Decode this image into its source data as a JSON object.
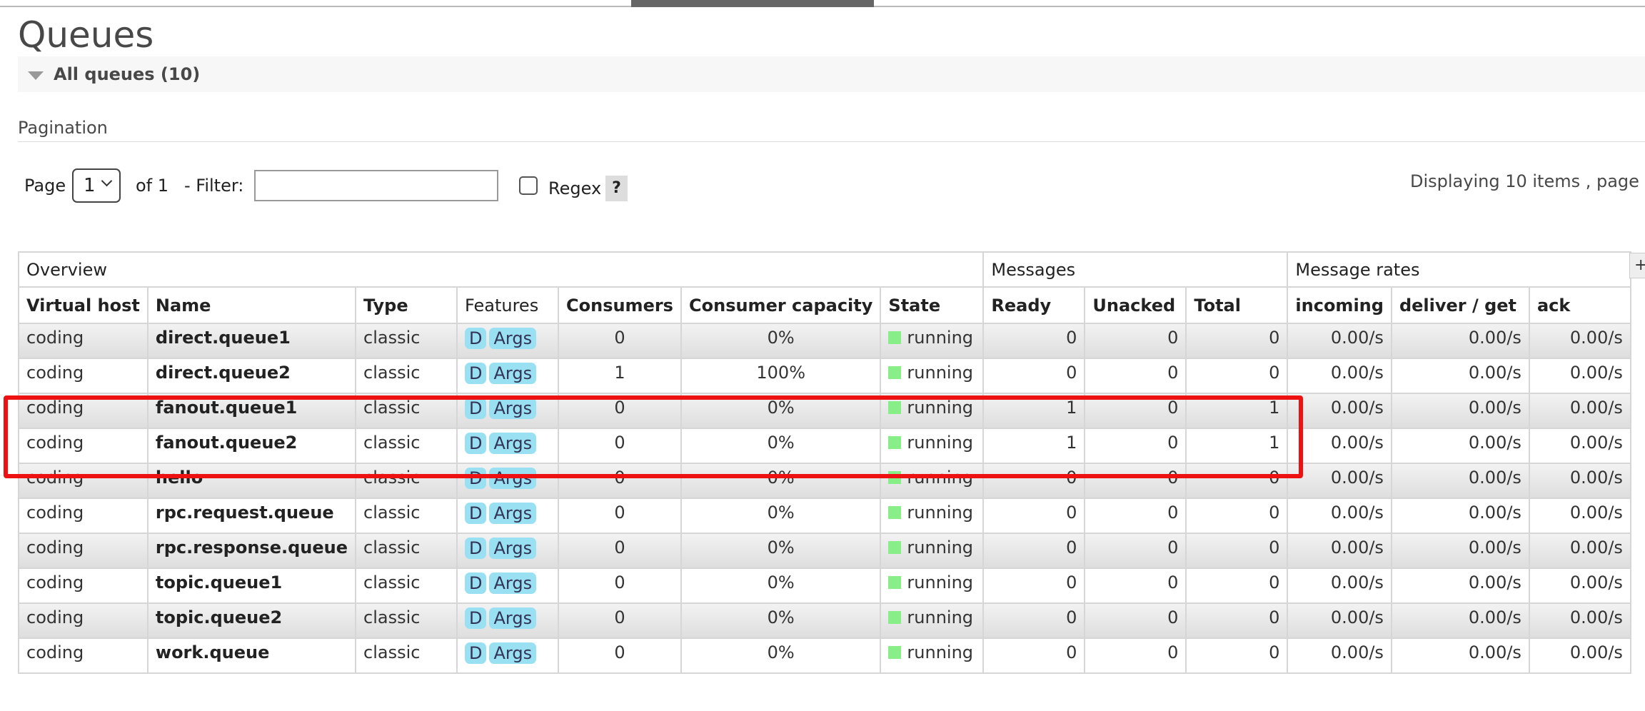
{
  "page": {
    "title": "Queues"
  },
  "section": {
    "label": "All queues (10)"
  },
  "pagination": {
    "label": "Pagination",
    "page_label": "Page",
    "page_value": "1",
    "of_label": "of 1",
    "filter_label": "- Filter:",
    "filter_value": "",
    "regex_label": "Regex",
    "regex_checked": false,
    "help_label": "?",
    "displaying": "Displaying 10 items , page"
  },
  "table": {
    "groups": [
      {
        "label": "Overview",
        "span": 7
      },
      {
        "label": "Messages",
        "span": 3
      },
      {
        "label": "Message rates",
        "span": 3
      }
    ],
    "side_button": "+",
    "columns": [
      "Virtual host",
      "Name",
      "Type",
      "Features",
      "Consumers",
      "Consumer capacity",
      "State",
      "Ready",
      "Unacked",
      "Total",
      "incoming",
      "deliver / get",
      "ack"
    ],
    "rows": [
      {
        "vhost": "coding",
        "name": "direct.queue1",
        "type": "classic",
        "features": [
          "D",
          "Args"
        ],
        "consumers": "0",
        "capacity": "0%",
        "state": "running",
        "ready": "0",
        "unacked": "0",
        "total": "0",
        "incoming": "0.00/s",
        "deliver_get": "0.00/s",
        "ack": "0.00/s"
      },
      {
        "vhost": "coding",
        "name": "direct.queue2",
        "type": "classic",
        "features": [
          "D",
          "Args"
        ],
        "consumers": "1",
        "capacity": "100%",
        "state": "running",
        "ready": "0",
        "unacked": "0",
        "total": "0",
        "incoming": "0.00/s",
        "deliver_get": "0.00/s",
        "ack": "0.00/s"
      },
      {
        "vhost": "coding",
        "name": "fanout.queue1",
        "type": "classic",
        "features": [
          "D",
          "Args"
        ],
        "consumers": "0",
        "capacity": "0%",
        "state": "running",
        "ready": "1",
        "unacked": "0",
        "total": "1",
        "incoming": "0.00/s",
        "deliver_get": "0.00/s",
        "ack": "0.00/s"
      },
      {
        "vhost": "coding",
        "name": "fanout.queue2",
        "type": "classic",
        "features": [
          "D",
          "Args"
        ],
        "consumers": "0",
        "capacity": "0%",
        "state": "running",
        "ready": "1",
        "unacked": "0",
        "total": "1",
        "incoming": "0.00/s",
        "deliver_get": "0.00/s",
        "ack": "0.00/s"
      },
      {
        "vhost": "coding",
        "name": "hello",
        "type": "classic",
        "features": [
          "D",
          "Args"
        ],
        "consumers": "0",
        "capacity": "0%",
        "state": "running",
        "ready": "0",
        "unacked": "0",
        "total": "0",
        "incoming": "0.00/s",
        "deliver_get": "0.00/s",
        "ack": "0.00/s"
      },
      {
        "vhost": "coding",
        "name": "rpc.request.queue",
        "type": "classic",
        "features": [
          "D",
          "Args"
        ],
        "consumers": "0",
        "capacity": "0%",
        "state": "running",
        "ready": "0",
        "unacked": "0",
        "total": "0",
        "incoming": "0.00/s",
        "deliver_get": "0.00/s",
        "ack": "0.00/s"
      },
      {
        "vhost": "coding",
        "name": "rpc.response.queue",
        "type": "classic",
        "features": [
          "D",
          "Args"
        ],
        "consumers": "0",
        "capacity": "0%",
        "state": "running",
        "ready": "0",
        "unacked": "0",
        "total": "0",
        "incoming": "0.00/s",
        "deliver_get": "0.00/s",
        "ack": "0.00/s"
      },
      {
        "vhost": "coding",
        "name": "topic.queue1",
        "type": "classic",
        "features": [
          "D",
          "Args"
        ],
        "consumers": "0",
        "capacity": "0%",
        "state": "running",
        "ready": "0",
        "unacked": "0",
        "total": "0",
        "incoming": "0.00/s",
        "deliver_get": "0.00/s",
        "ack": "0.00/s"
      },
      {
        "vhost": "coding",
        "name": "topic.queue2",
        "type": "classic",
        "features": [
          "D",
          "Args"
        ],
        "consumers": "0",
        "capacity": "0%",
        "state": "running",
        "ready": "0",
        "unacked": "0",
        "total": "0",
        "incoming": "0.00/s",
        "deliver_get": "0.00/s",
        "ack": "0.00/s"
      },
      {
        "vhost": "coding",
        "name": "work.queue",
        "type": "classic",
        "features": [
          "D",
          "Args"
        ],
        "consumers": "0",
        "capacity": "0%",
        "state": "running",
        "ready": "0",
        "unacked": "0",
        "total": "0",
        "incoming": "0.00/s",
        "deliver_get": "0.00/s",
        "ack": "0.00/s"
      }
    ]
  },
  "colors": {
    "highlight": "#ee1111",
    "state_running": "#88ee88",
    "feature_tag": "#99e0f2"
  }
}
